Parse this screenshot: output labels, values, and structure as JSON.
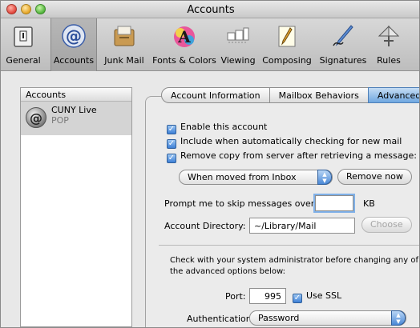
{
  "window": {
    "title": "Accounts"
  },
  "toolbar": {
    "items": [
      {
        "label": "General",
        "icon": "general-icon"
      },
      {
        "label": "Accounts",
        "icon": "at-sign-icon"
      },
      {
        "label": "Junk Mail",
        "icon": "junk-mail-icon"
      },
      {
        "label": "Fonts & Colors",
        "icon": "fonts-colors-icon"
      },
      {
        "label": "Viewing",
        "icon": "viewing-icon"
      },
      {
        "label": "Composing",
        "icon": "composing-icon"
      },
      {
        "label": "Signatures",
        "icon": "signatures-icon"
      },
      {
        "label": "Rules",
        "icon": "rules-icon"
      }
    ],
    "selected": "Accounts"
  },
  "accounts": {
    "header": "Accounts",
    "list": [
      {
        "name": "CUNY Live",
        "type": "POP"
      }
    ]
  },
  "tabs": [
    "Account Information",
    "Mailbox Behaviors",
    "Advanced"
  ],
  "active_tab": "Advanced",
  "advanced": {
    "enable_account": "Enable this account",
    "include_check": "Include when automatically checking for new mail",
    "remove_copy": "Remove copy from server after retrieving a message:",
    "remove_when": "When moved from Inbox",
    "remove_now": "Remove now",
    "prompt_label": "Prompt me to skip messages over",
    "prompt_value": "",
    "kb": "KB",
    "dir_label": "Account Directory:",
    "dir_value": "~/Library/Mail",
    "choose": "Choose",
    "note": "Check with your system administrator before changing any of the advanced options below:",
    "port_label": "Port:",
    "port_value": "995",
    "use_ssl": "Use SSL",
    "auth_label": "Authentication:",
    "auth_value": "Password"
  },
  "colors": {
    "accent": "#3d7fd6",
    "selected_tab": "#6fa6e0"
  }
}
